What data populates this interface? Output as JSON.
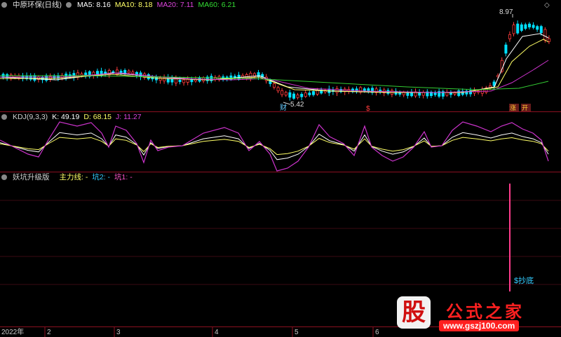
{
  "main_panel": {
    "title": "中原环保(日线)",
    "ma5": "MA5: 8.16",
    "ma10": "MA10: 8.18",
    "ma20": "MA20: 7.11",
    "ma60": "MA60: 6.21",
    "high_label": "8.97",
    "low_label": "5.42",
    "markers": {
      "cai": "财",
      "dollar": "$",
      "zhang": "涨",
      "kai": "开"
    }
  },
  "kdj_panel": {
    "title": "KDJ(9,3,3)",
    "k": "K: 49.19",
    "d": "D: 68.15",
    "j": "J: 11.27"
  },
  "indicator_panel": {
    "title": "妖坑升级版",
    "main_line": "主力线: -",
    "pit2": "坑2: -",
    "pit1": "坑1: -",
    "signal": "$抄底"
  },
  "x_axis": {
    "year": "2022年",
    "ticks": [
      "2",
      "3",
      "4",
      "5",
      "6"
    ]
  },
  "watermark": {
    "logo": "股",
    "name": "公式之家",
    "url": "www.gszj100.com"
  },
  "colors": {
    "up": "#ff3c3c",
    "down": "#00e0ff",
    "ma5": "#ffffff",
    "ma10": "#ffff66",
    "ma20": "#cc33cc",
    "ma60": "#33cc33",
    "divider": "#8b1020"
  },
  "controls": {
    "settings_icon": "diamond-icon",
    "expand_icon": "chevron-up-icon"
  }
}
